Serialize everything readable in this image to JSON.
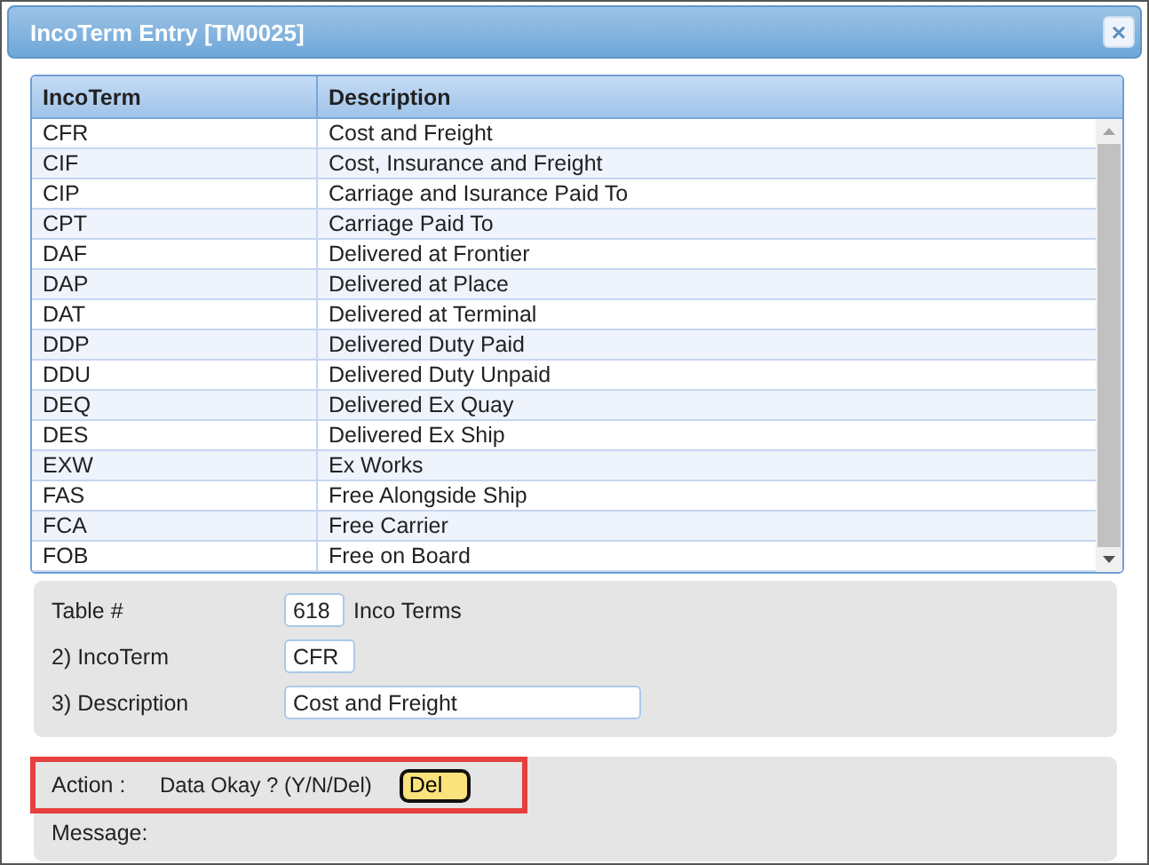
{
  "window": {
    "title": "IncoTerm Entry [TM0025]",
    "close": "×"
  },
  "table": {
    "columns": [
      "IncoTerm",
      "Description"
    ],
    "rows": [
      [
        "CFR",
        "Cost and Freight"
      ],
      [
        "CIF",
        "Cost, Insurance and Freight"
      ],
      [
        "CIP",
        "Carriage and Isurance Paid To"
      ],
      [
        "CPT",
        "Carriage Paid To"
      ],
      [
        "DAF",
        "Delivered at Frontier"
      ],
      [
        "DAP",
        "Delivered at Place"
      ],
      [
        "DAT",
        "Delivered at Terminal"
      ],
      [
        "DDP",
        "Delivered Duty Paid"
      ],
      [
        "DDU",
        "Delivered Duty Unpaid"
      ],
      [
        "DEQ",
        "Delivered Ex Quay"
      ],
      [
        "DES",
        "Delivered Ex Ship"
      ],
      [
        "EXW",
        "Ex Works"
      ],
      [
        "FAS",
        "Free Alongside Ship"
      ],
      [
        "FCA",
        "Free Carrier"
      ],
      [
        "FOB",
        "Free on Board"
      ]
    ]
  },
  "form": {
    "fields": [
      {
        "label": "Table #",
        "value": "618",
        "suffix": "Inco Terms"
      },
      {
        "label": "2) IncoTerm",
        "value": "CFR"
      },
      {
        "label": "3) Description",
        "value": "Cost and Freight"
      }
    ]
  },
  "action": {
    "label": "Action :",
    "prompt": "Data Okay ? (Y/N/Del)",
    "value": "Del",
    "highlighted": true,
    "message_label": "Message:"
  }
}
